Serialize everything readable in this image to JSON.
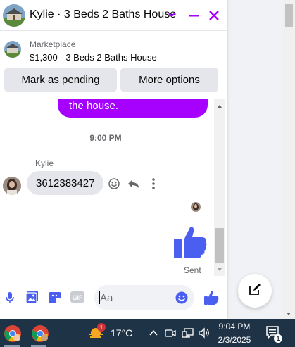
{
  "header": {
    "title": "Kylie · 3 Beds 2 Baths House"
  },
  "marketplace": {
    "label": "Marketplace",
    "listing": "$1,300 - 3 Beds 2 Baths House"
  },
  "actions": {
    "mark_pending": "Mark as pending",
    "more_options": "More options"
  },
  "messages": {
    "outgoing_tail": "the house.",
    "timestamp": "9:00 PM",
    "sender": "Kylie",
    "incoming": "3612383427",
    "status": "Sent"
  },
  "composer": {
    "placeholder": "Aa"
  },
  "taskbar": {
    "weather_badge": "1",
    "temperature": "17°C",
    "time": "9:04 PM",
    "date": "2/3/2025",
    "notification_count": "1"
  },
  "colors": {
    "accent": "#a600ff",
    "like_blue": "#4a5ef0",
    "taskbar": "#1e3346"
  },
  "icons": [
    "house-avatar",
    "chevron-down-icon",
    "minimize-icon",
    "close-icon",
    "emoji-icon",
    "reply-icon",
    "more-vertical-icon",
    "thumbs-up-icon",
    "microphone-icon",
    "photo-icon",
    "sticker-icon",
    "gif-icon",
    "compose-icon",
    "chrome-icon",
    "weather-icon",
    "network-icon",
    "volume-icon",
    "notification-icon"
  ]
}
